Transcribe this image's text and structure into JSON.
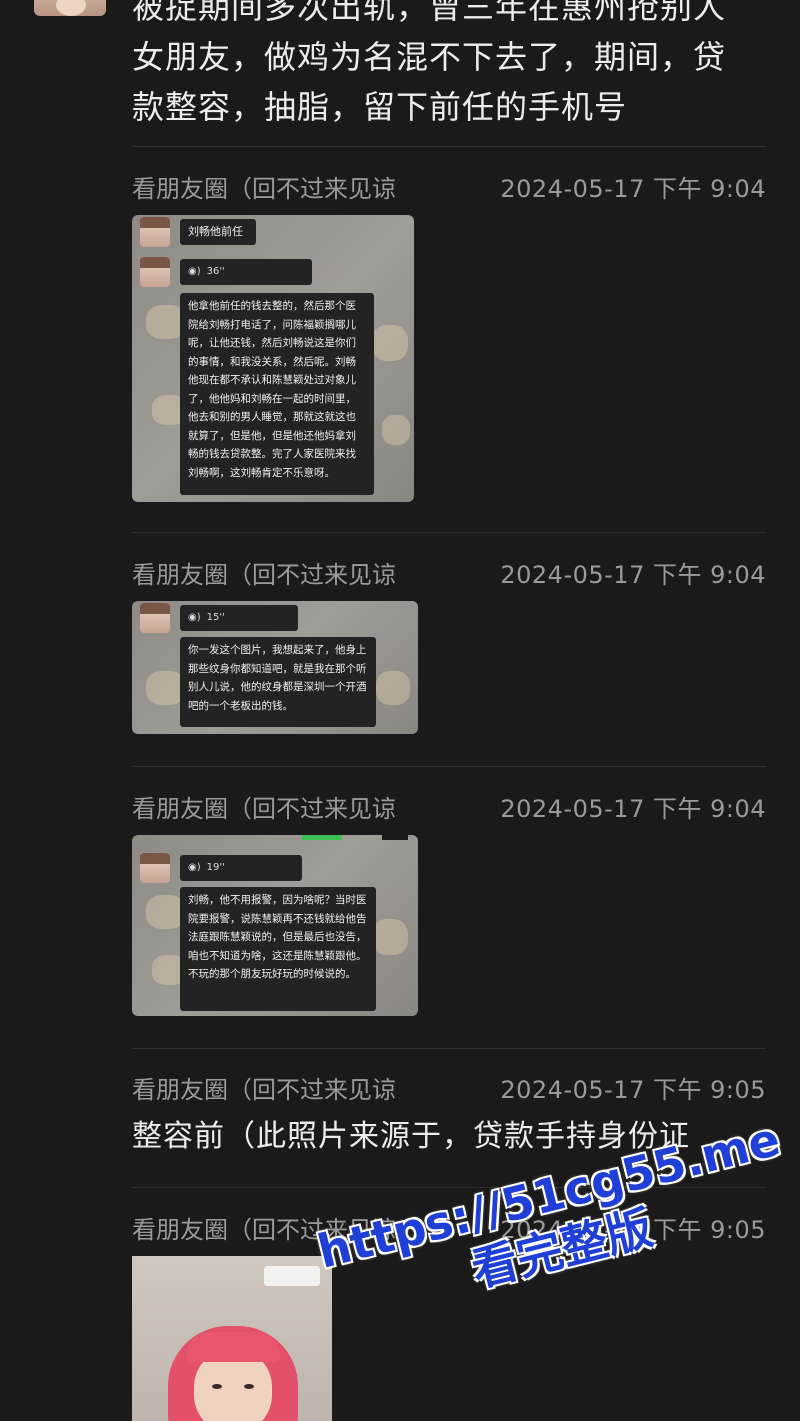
{
  "intro": {
    "text": "被捉期间多次出轨，曾三年在惠州抢别人女朋友，做鸡为名混不下去了，期间，贷款整容，抽脂，留下前任的手机号"
  },
  "messages": [
    {
      "sender": "看朋友圈（回不过来见谅",
      "time": "2024-05-17 下午 9:04",
      "shot": {
        "label": "刘畅他前任",
        "voice_duration": "36''",
        "transcript": "他拿他前任的钱去整的，然后那个医院给刘畅打电话了，问陈福颖搁哪儿呢，让他还钱，然后刘畅说这是你们的事情，和我没关系，然后呢。刘畅他现在都不承认和陈慧颖处过对象儿了，他他妈和刘畅在一起的时间里，他去和别的男人睡觉，那就这就这也就算了，但是他，但是他还他妈拿刘畅的钱去贷款整。完了人家医院来找刘畅啊，这刘畅肯定不乐意呀。"
      }
    },
    {
      "sender": "看朋友圈（回不过来见谅",
      "time": "2024-05-17 下午 9:04",
      "shot": {
        "voice_duration": "15''",
        "transcript": "你一发这个图片，我想起来了，他身上那些纹身你都知道吧，就是我在那个听别人儿说，他的纹身都是深圳一个开酒吧的一个老板出的钱。"
      }
    },
    {
      "sender": "看朋友圈（回不过来见谅",
      "time": "2024-05-17 下午 9:04",
      "shot": {
        "voice_duration": "19''",
        "transcript": "刘畅，他不用报警，因为啥呢？当时医院要报警，说陈慧颖再不还钱就给他告法庭跟陈慧颖说的，但是最后也没告，咱也不知道为啥，这还是陈慧颖跟他。不玩的那个朋友玩好玩的时候说的。"
      }
    },
    {
      "sender": "看朋友圈（回不过来见谅",
      "time": "2024-05-17 下午 9:05",
      "text": "整容前（此照片来源于，贷款手持身份证"
    },
    {
      "sender": "看朋友圈（回不过来见谅",
      "time": "2024-05-17 下午 9:05"
    }
  ],
  "watermark": {
    "line1": "https://51cg55.me",
    "line2": "看完整版"
  },
  "icons": {
    "voice": "voice-wave-icon"
  }
}
